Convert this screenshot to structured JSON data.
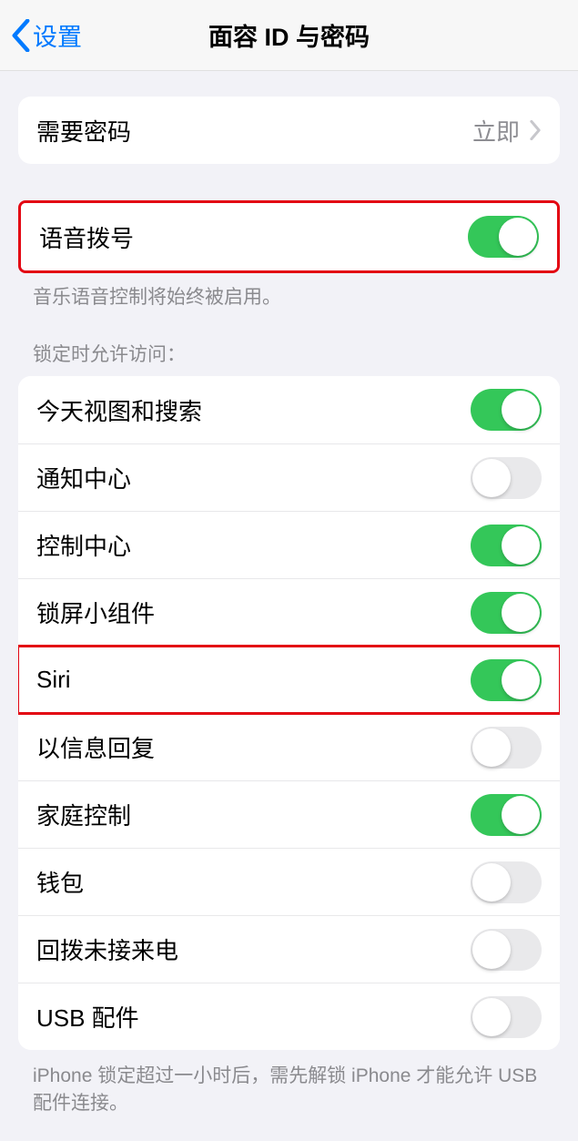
{
  "nav": {
    "back_label": "设置",
    "title": "面容 ID 与密码"
  },
  "passcode": {
    "label": "需要密码",
    "value": "立即"
  },
  "voice_dial": {
    "label": "语音拨号",
    "on": true,
    "footer": "音乐语音控制将始终被启用。"
  },
  "lock_access": {
    "header": "锁定时允许访问：",
    "items": [
      {
        "label": "今天视图和搜索",
        "on": true,
        "highlight": false
      },
      {
        "label": "通知中心",
        "on": false,
        "highlight": false
      },
      {
        "label": "控制中心",
        "on": true,
        "highlight": false
      },
      {
        "label": "锁屏小组件",
        "on": true,
        "highlight": false
      },
      {
        "label": "Siri",
        "on": true,
        "highlight": true
      },
      {
        "label": "以信息回复",
        "on": false,
        "highlight": false
      },
      {
        "label": "家庭控制",
        "on": true,
        "highlight": false
      },
      {
        "label": "钱包",
        "on": false,
        "highlight": false
      },
      {
        "label": "回拨未接来电",
        "on": false,
        "highlight": false
      },
      {
        "label": "USB 配件",
        "on": false,
        "highlight": false
      }
    ],
    "footer": "iPhone 锁定超过一小时后，需先解锁 iPhone 才能允许 USB 配件连接。"
  }
}
